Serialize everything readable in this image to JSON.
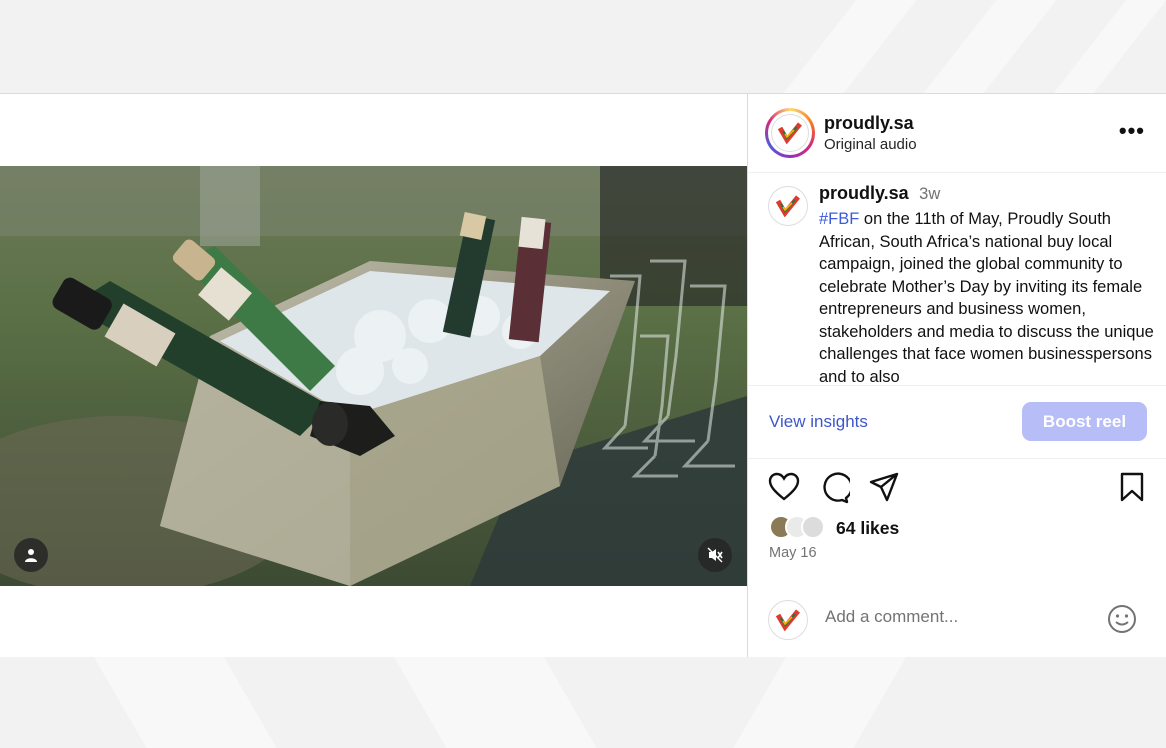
{
  "post": {
    "username": "proudly.sa",
    "audio": "Original audio",
    "more_label": "•••"
  },
  "caption": {
    "username": "proudly.sa",
    "time_ago": "3w",
    "hashtag": "#FBF",
    "text": " on the 11th of May, Proudly South African, South Africa’s national buy local campaign, joined the global community to celebrate Mother’s Day by inviting its female entrepreneurs and business women, stakeholders and media to discuss the unique challenges that face women businesspersons and to also"
  },
  "actions": {
    "insights_label": "View insights",
    "boost_label": "Boost reel"
  },
  "stats": {
    "likes": "64 likes",
    "date": "May 16"
  },
  "comment": {
    "placeholder": "Add a comment..."
  },
  "icons": {
    "like": "heart-icon",
    "comment": "comment-icon",
    "share": "share-icon",
    "save": "bookmark-icon",
    "emoji": "emoji-icon",
    "mute": "muted-speaker-icon",
    "tagged_user": "user-icon"
  },
  "colors": {
    "link": "#3d57c9",
    "boost_button": "#b6bdf7",
    "secondary_text": "#737373"
  }
}
